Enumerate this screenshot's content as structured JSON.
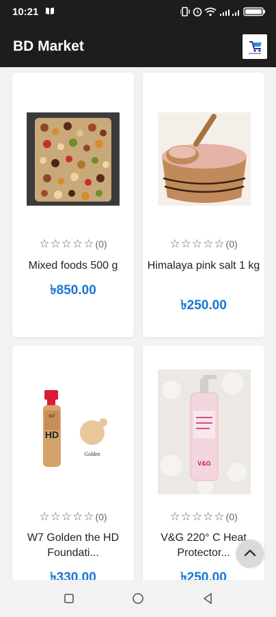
{
  "status_bar": {
    "time": "10:21"
  },
  "app_bar": {
    "title": "BD Market"
  },
  "products": [
    {
      "name": "Mixed foods 500 g",
      "rating_count": "(0)",
      "price": "৳850.00",
      "stars": 0
    },
    {
      "name": "Himalaya pink salt 1 kg",
      "rating_count": "(0)",
      "price": "৳250.00",
      "stars": 0
    },
    {
      "name": "W7 Golden the HD Foundati...",
      "rating_count": "(0)",
      "price": "৳330.00",
      "stars": 0
    },
    {
      "name": "V&G 220° C Heat Protector...",
      "rating_count": "(0)",
      "price": "৳250.00",
      "stars": 0
    }
  ],
  "product_images": {
    "label_hd": "HD",
    "label_golden": "Golden",
    "label_w7": "W7",
    "label_brand": "V&G"
  },
  "icons": {
    "scroll_top": "chevron-up-icon",
    "nav_recents": "square-icon",
    "nav_home": "circle-icon",
    "nav_back": "triangle-back-icon"
  },
  "colors": {
    "price": "#1976d2",
    "app_bar": "#1d1d1d"
  }
}
